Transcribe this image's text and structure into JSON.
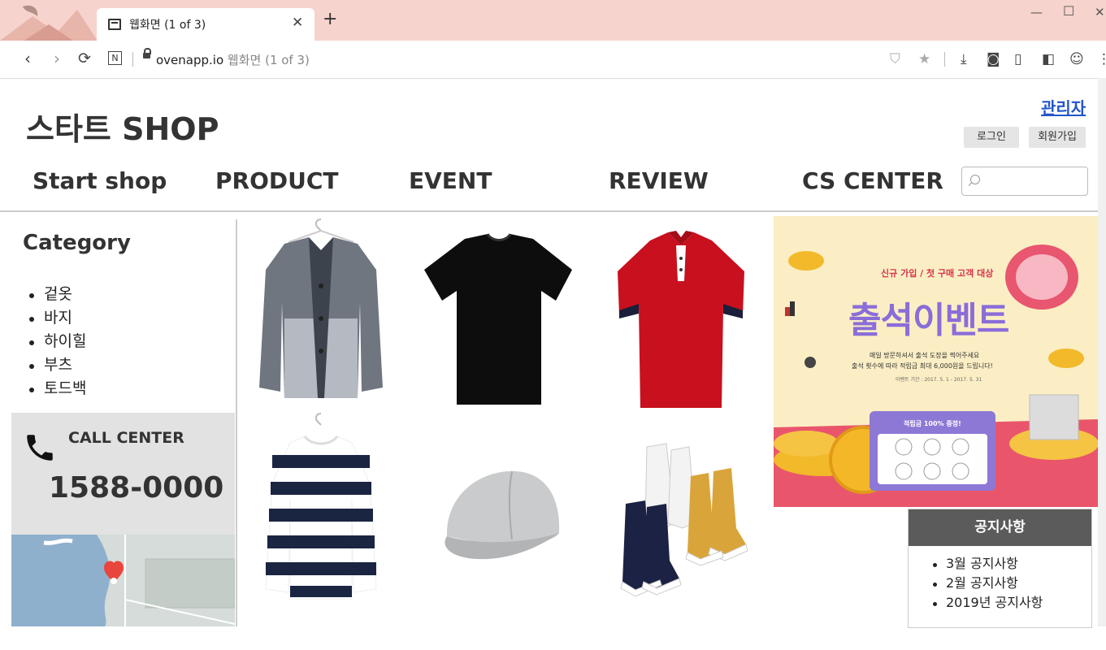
{
  "browser": {
    "tab_title": "웹화면 (1 of 3)",
    "url_host": "ovenapp.io",
    "url_page_title": "웹화면 (1 of 3)"
  },
  "header": {
    "logo": "스타트 SHOP",
    "admin_link": "관리자",
    "login_button": "로그인",
    "signup_button": "회원가입"
  },
  "nav": {
    "items": [
      "Start shop",
      "PRODUCT",
      "EVENT",
      "REVIEW",
      "CS CENTER"
    ]
  },
  "sidebar": {
    "category_title": "Category",
    "categories": [
      "겉옷",
      "바지",
      "하이힐",
      "부츠",
      "토드백"
    ],
    "call_center_label": "CALL CENTER",
    "call_center_number": "1588-0000"
  },
  "banner": {
    "top_text": "신규 가입 / 첫 구매 고객 대상",
    "headline": "출석이벤트",
    "desc1": "매일 방문하셔서 출석 도장을 찍어주세요",
    "desc2": "출석 횟수에 따라 적립금 최대 6,000원을 드립니다!",
    "period": "이벤트 기간 : 2017. 5. 1 - 2017. 5. 31",
    "card_label": "적립금 100% 증정!"
  },
  "notice": {
    "title": "공지사항",
    "items": [
      "3월 공지사항",
      "2월 공지사항",
      "2019년 공지사항"
    ]
  },
  "colors": {
    "titlebar": "#f7d3cd",
    "admin_link": "#2255cc",
    "notice_header": "#5b5b5b"
  }
}
